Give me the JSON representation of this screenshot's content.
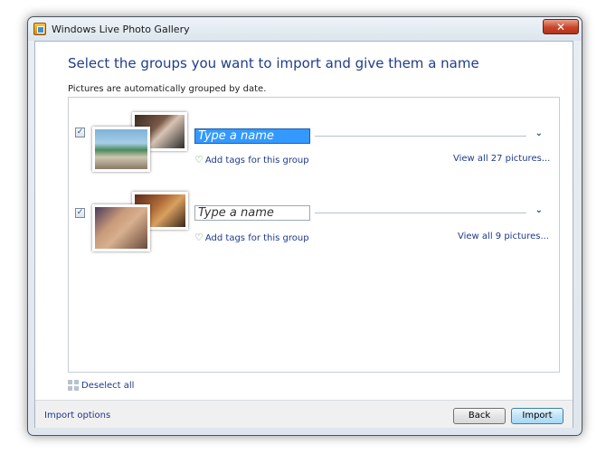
{
  "window": {
    "title": "Windows Live Photo Gallery",
    "close_glyph": "✕"
  },
  "page": {
    "heading": "Select the groups you want to import and give them a name",
    "subtext": "Pictures are automatically grouped by date."
  },
  "groups": [
    {
      "checked": true,
      "name_placeholder": "Type a name",
      "add_tags_label": "Add tags for this group",
      "view_all_label": "View all 27 pictures..."
    },
    {
      "checked": true,
      "name_placeholder": "Type a name",
      "add_tags_label": "Add tags for this group",
      "view_all_label": "View all 9 pictures..."
    }
  ],
  "deselect_label": "Deselect all",
  "footer": {
    "import_options_label": "Import options",
    "back_label": "Back",
    "import_label": "Import"
  },
  "icons": {
    "check": "✓",
    "chevron": "⌄",
    "tag": "♡"
  }
}
